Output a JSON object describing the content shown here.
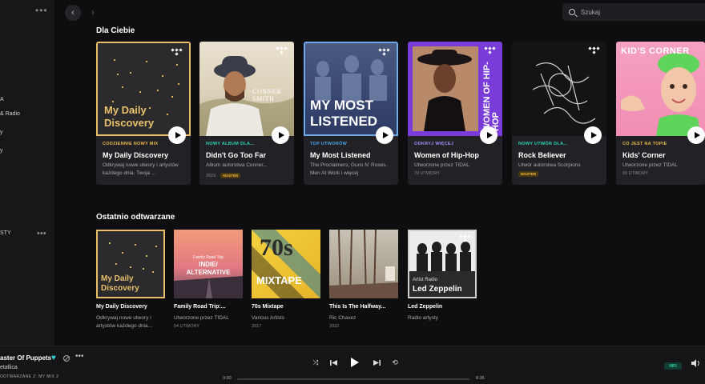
{
  "sidebar": {
    "items": [
      {
        "label": "A"
      },
      {
        "label": "& Radio"
      },
      {
        "label": "y"
      },
      {
        "label": "y"
      },
      {
        "label": "STY"
      }
    ]
  },
  "search": {
    "placeholder": "Szukaj"
  },
  "sections": {
    "for_you": "Dla Ciebie",
    "recent": "Ostatnio odtwarzane"
  },
  "for_you_cards": [
    {
      "cover_text": "My Daily Discovery",
      "tag": "CODZIENNIE NOWY MIX",
      "tag_color": "#e8b84a",
      "title": "My Daily Discovery",
      "subtitle": "Odkrywaj nowe utwory i artystów każdego dnia. Twoja ...",
      "meta": "",
      "badge": ""
    },
    {
      "cover_text": "CONNER SMITH",
      "tag": "NOWY ALBUM DLA...",
      "tag_color": "#2ed3b7",
      "title": "Didn't Go Too Far",
      "subtitle": "Album autorstwa Conner...",
      "meta": "2023",
      "badge": "MASTER"
    },
    {
      "cover_text": "MY MOST LISTENED",
      "tag": "TOP UTWORÓW",
      "tag_color": "#4aa3e8",
      "title": "My Most Listened",
      "subtitle": "The Proclaimers, Guns N' Roses, Men At Work i więcej",
      "meta": "",
      "badge": ""
    },
    {
      "cover_text": "WOMEN OF HIP-HOP",
      "tag": "ODKRYJ WIĘCEJ",
      "tag_color": "#a78bfa",
      "title": "Women of Hip-Hop",
      "subtitle": "Utworzone przez TIDAL",
      "meta": "79 UTWORY",
      "badge": ""
    },
    {
      "cover_text": "",
      "tag": "NOWY UTWÓR DLA...",
      "tag_color": "#2ed3b7",
      "title": "Rock Believer",
      "subtitle": "Utwór autorstwa Scorpions",
      "meta": "",
      "badge": "MASTER"
    },
    {
      "cover_text": "KID'S CORNER",
      "tag": "CO JEST NA TOPIE",
      "tag_color": "#e8b84a",
      "title": "Kids' Corner",
      "subtitle": "Utworzone przez TIDAL",
      "meta": "65 UTWORY",
      "badge": ""
    }
  ],
  "recent_cards": [
    {
      "cover_text": "My Daily Discovery",
      "title": "My Daily Discovery",
      "subtitle": "Odkrywaj nowe utwory i artystów każdego dnia..."
    },
    {
      "cover_text": "Family Road Trip INDIE/ ALTERNATIVE",
      "cover_small": "Family Road Trip",
      "cover_big": "INDIE/ ALTERNATIVE",
      "title": "Family Road Trip:...",
      "subtitle": "Utworzone przez TIDAL",
      "meta": "54 UTWORY"
    },
    {
      "cover_text": "70s MIXTAPE",
      "cover_big": "70s",
      "cover_small": "MIXTAPE",
      "title": "70s Mixtape",
      "subtitle": "Various Artists",
      "meta": "2017"
    },
    {
      "cover_text": "",
      "title": "This Is The Halfway...",
      "subtitle": "Ric Chavez",
      "meta": "2022"
    },
    {
      "cover_small": "Artist Radio",
      "cover_big": "Led Zeppelin",
      "title": "Led Zeppelin",
      "subtitle": "Radio artysty",
      "meta": ""
    }
  ],
  "player": {
    "title": "aster Of Puppets",
    "artist": "etallica",
    "source": "ODTWARZANE Z: MY MIX 2",
    "time_current": "0:00",
    "time_total": "8:35",
    "progress": 0.0,
    "quality": "HIFI"
  },
  "colors": {
    "accent": "#2ed3d3",
    "background": "#0e0e10",
    "card": "#222226"
  }
}
